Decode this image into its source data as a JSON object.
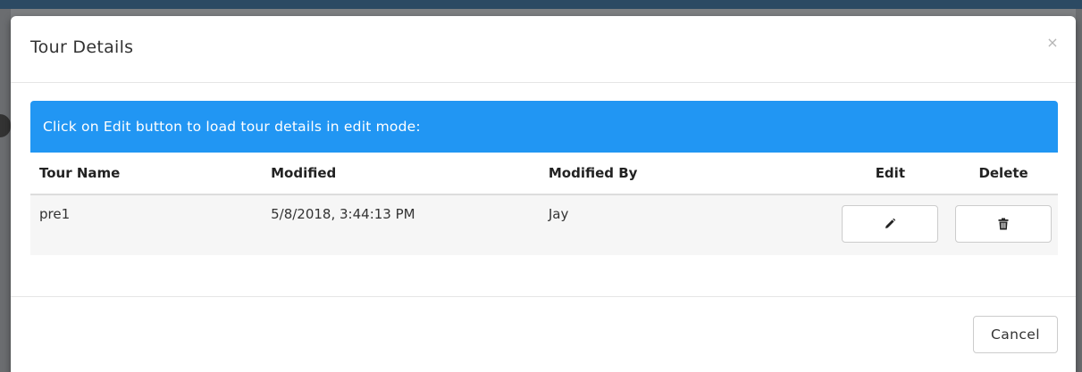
{
  "modal": {
    "title": "Tour Details",
    "close_glyph": "×",
    "alert_text": "Click on Edit button to load tour details in edit mode:",
    "cancel_label": "Cancel"
  },
  "table": {
    "columns": {
      "tour_name": "Tour Name",
      "modified": "Modified",
      "modified_by": "Modified By",
      "edit": "Edit",
      "delete": "Delete"
    },
    "rows": [
      {
        "tour_name": "pre1",
        "modified": "5/8/2018, 3:44:13 PM",
        "modified_by": "Jay",
        "edit_icon": "pencil-icon",
        "delete_icon": "trash-icon"
      }
    ]
  },
  "colors": {
    "alert_bg": "#2196f3",
    "row_bg": "#f6f6f6",
    "backdrop": "#7d7f82"
  }
}
